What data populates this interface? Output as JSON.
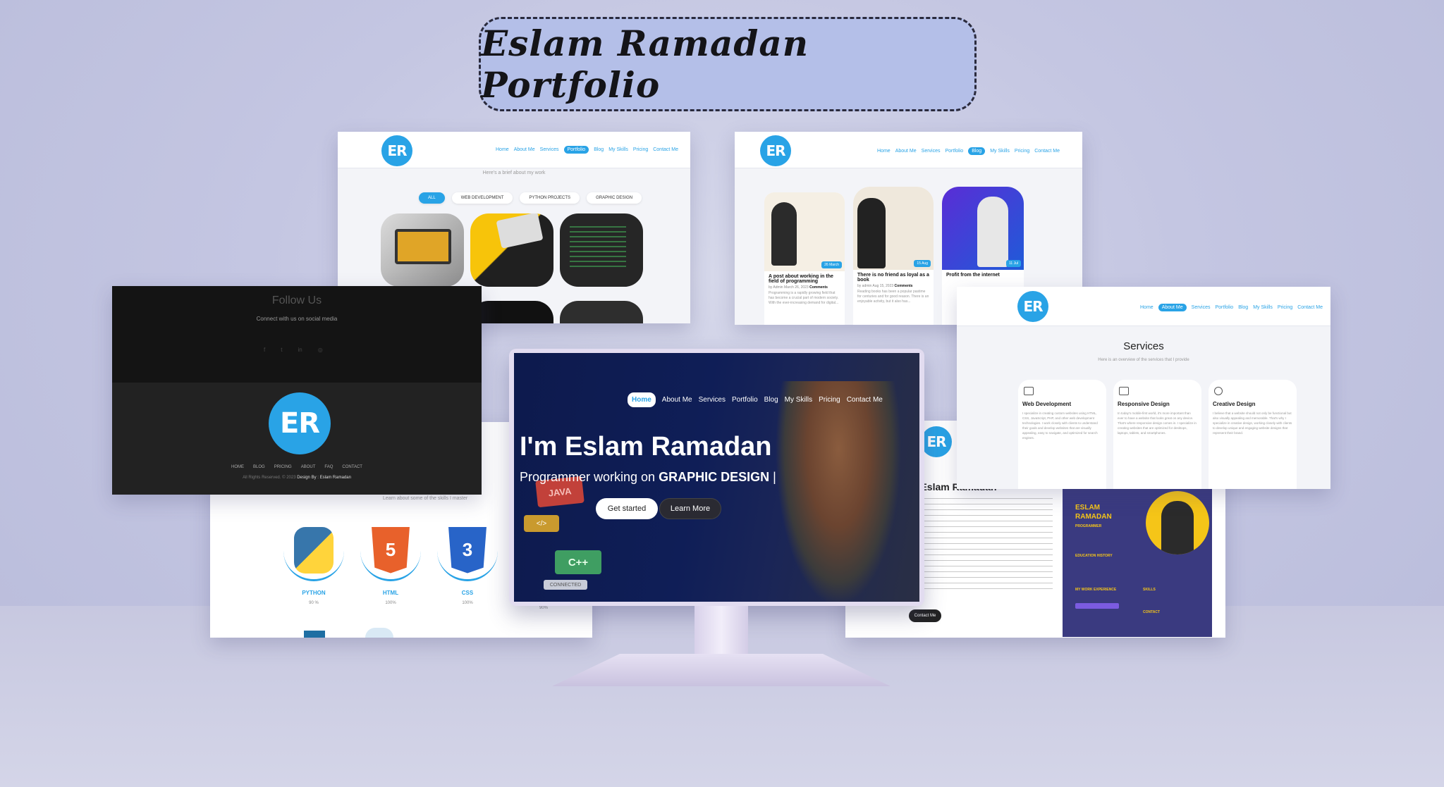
{
  "title": "Eslam Ramadan Portfolio",
  "logo_text": "ER",
  "colors": {
    "accent": "#29a3e6",
    "hero_bg": "#0f1e57",
    "pill_bg": "#b4bfe8"
  },
  "portfolio": {
    "nav": [
      "Home",
      "About Me",
      "Services",
      "Portfolio",
      "Blog",
      "My Skills",
      "Pricing",
      "Contact Me"
    ],
    "active": "Portfolio",
    "subtitle": "Here's a brief about my work",
    "filters": [
      "ALL",
      "WEB DEVELOPMENT",
      "PYTHON PROJECTS",
      "GRAPHIC DESIGN"
    ]
  },
  "blog": {
    "nav": [
      "Home",
      "About Me",
      "Services",
      "Portfolio",
      "Blog",
      "My Skills",
      "Pricing",
      "Contact Me"
    ],
    "active": "Blog",
    "posts": [
      {
        "title": "A post about working in the field of programming",
        "meta": "by Admin March 26, 2023",
        "comments": "Comments",
        "badge": "26 March",
        "text": "Programming is a rapidly growing field that has become a crucial part of modern society. With the ever-increasing demand for digital..."
      },
      {
        "title": "There is no friend as loyal as a book",
        "meta": "by admin Aug 15, 2023",
        "comments": "Comments",
        "badge": "15 Aug",
        "text": "Reading books has been a popular pastime for centuries and for good reason. There is an enjoyable activity, but it also has..."
      },
      {
        "title": "Profit from the internet",
        "badge": "11 Jul"
      }
    ]
  },
  "footer": {
    "heading": "Follow Us",
    "subheading": "Connect with us on social media",
    "links": [
      "HOME",
      "BLOG",
      "PRICING",
      "ABOUT",
      "FAQ",
      "CONTACT"
    ],
    "copyright": "All Rights Reserved. © 2023",
    "design_by": "Design By : Eslam Ramadan"
  },
  "services": {
    "nav": [
      "Home",
      "About Me",
      "Services",
      "Portfolio",
      "Blog",
      "My Skills",
      "Pricing",
      "Contact Me"
    ],
    "active": "About Me",
    "heading": "Services",
    "subheading": "Here is an overview of the services that I provide",
    "items": [
      {
        "title": "Web Development",
        "icon": "code-icon",
        "text": "I specialize in creating custom websites using HTML, CSS, JavaScript, PHP, and other web development technologies. I work closely with clients to understand their goals and develop websites that are visually appealing, easy to navigate, and optimized for search engines."
      },
      {
        "title": "Responsive Design",
        "icon": "devices-icon",
        "text": "In today's mobile-first world, it's more important than ever to have a website that looks great on any device. That's where responsive design comes in. I specialize in creating websites that are optimized for desktops, laptops, tablets, and smartphones."
      },
      {
        "title": "Creative Design",
        "icon": "pen-icon",
        "text": "I believe that a website should not only be functional but also visually appealing and memorable. That's why I specialize in creative design, working closely with clients to develop unique and engaging website designs that represent their brand."
      }
    ]
  },
  "skills": {
    "subheading": "Learn about some of the skills I master",
    "items": [
      {
        "name": "PYTHON",
        "pct": "90 %"
      },
      {
        "name": "HTML",
        "pct": "100%"
      },
      {
        "name": "CSS",
        "pct": "100%"
      },
      {
        "name": "",
        "pct": "90%"
      }
    ]
  },
  "hero": {
    "nav": [
      "Home",
      "About Me",
      "Services",
      "Portfolio",
      "Blog",
      "My Skills",
      "Pricing",
      "Contact Me"
    ],
    "active": "Home",
    "heading": "I'm Eslam Ramadan",
    "sub_prefix": "Programmer working on",
    "sub_highlight": "GRAPHIC DESIGN",
    "btn_primary": "Get started",
    "btn_secondary": "Learn More",
    "cards": [
      "JAVA",
      "</>",
      "C++",
      "CONNECTED"
    ]
  },
  "about": {
    "heading": "n Eslam Ramadan",
    "button": "Contact Me"
  },
  "resume": {
    "name_line1": "ESLAM",
    "name_line2": "RAMADAN",
    "role": "PROGRAMMER",
    "sections": [
      "EDUCATION HISTORY",
      "MY WORK EXPERIENCE",
      "SKILLS",
      "CONTACT"
    ]
  }
}
